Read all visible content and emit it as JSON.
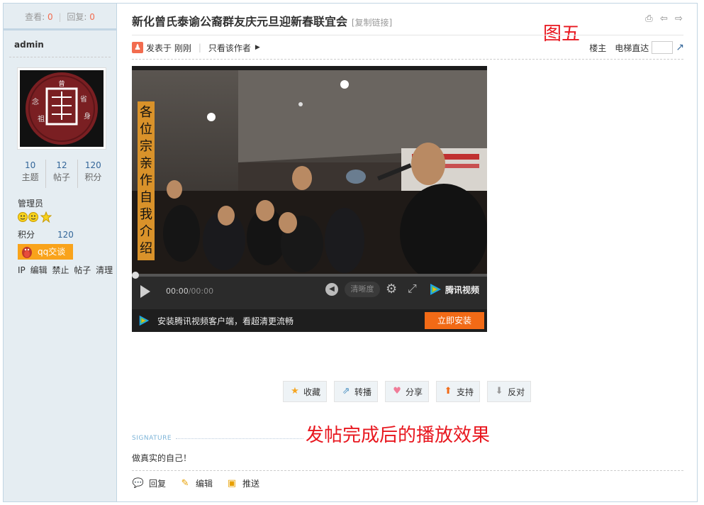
{
  "sidebar": {
    "stats": {
      "views_label": "查看:",
      "views": "0",
      "replies_label": "回复:",
      "replies": "0"
    },
    "username": "admin",
    "avatar_chars": {
      "center": "曾",
      "left_top": "念",
      "left_bottom": "祖",
      "right_top": "省",
      "right_bottom": "身"
    },
    "counts": [
      {
        "value": "10",
        "label": "主题"
      },
      {
        "value": "12",
        "label": "帖子"
      },
      {
        "value": "120",
        "label": "积分"
      }
    ],
    "role": "管理员",
    "score_label": "积分",
    "score_value": "120",
    "qq_label": "qq交谈",
    "admin_links": [
      "IP",
      "编辑",
      "禁止",
      "帖子",
      "清理"
    ]
  },
  "post": {
    "title": "新化曾氏泰谕公裔群友庆元旦迎新春联宜会",
    "copy_link": "[复制链接]",
    "annotation_top": "图五",
    "posted": "发表于 刚刚",
    "author_only": "只看该作者",
    "floor": "楼主",
    "elevator": "电梯直达",
    "elevator_value": ""
  },
  "video": {
    "side_caption": "各位宗亲作自我介绍",
    "time_current": "00:00",
    "time_total": "/00:00",
    "quality": "清晰度",
    "brand": "腾讯视频",
    "ad_text": "安装腾讯视频客户端，看超清更流畅",
    "install_button": "立即安装",
    "progress": 0
  },
  "actions": [
    {
      "label": "收藏",
      "icon": "star-icon",
      "color": "#f5a623"
    },
    {
      "label": "转播",
      "icon": "share-out-icon",
      "color": "#4a90c2"
    },
    {
      "label": "分享",
      "icon": "heart-icon",
      "color": "#f07c98"
    },
    {
      "label": "支持",
      "icon": "thumb-up-icon",
      "color": "#f26a16"
    },
    {
      "label": "反对",
      "icon": "thumb-down-icon",
      "color": "#999999"
    }
  ],
  "annotation_bottom": "发帖完成后的播放效果",
  "signature": {
    "label": "SIGNATURE",
    "text": "做真实的自己！"
  },
  "bottom_bar": [
    {
      "label": "回复",
      "icon": "reply-icon"
    },
    {
      "label": "编辑",
      "icon": "edit-pencil-icon"
    },
    {
      "label": "推送",
      "icon": "push-icon"
    }
  ],
  "colors": {
    "accent": "#f26c4f",
    "link": "#336699",
    "sidebar_bg": "#e5edf2",
    "border": "#c2d5e3",
    "annotation": "#e8171f"
  }
}
